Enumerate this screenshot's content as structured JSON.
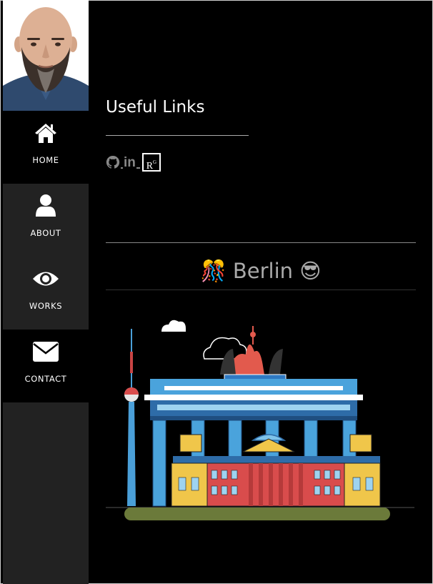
{
  "nav": {
    "items": [
      {
        "label": "HOME",
        "icon": "home-icon"
      },
      {
        "label": "ABOUT",
        "icon": "user-icon"
      },
      {
        "label": "WORKS",
        "icon": "eye-icon"
      },
      {
        "label": "CONTACT",
        "icon": "envelope-icon"
      }
    ]
  },
  "useful_links": {
    "title": "Useful Links",
    "links": [
      {
        "icon": "github-icon"
      },
      {
        "icon": "linkedin-icon",
        "text": "in"
      },
      {
        "icon": "researchgate-icon",
        "text": "R",
        "sup": "G"
      }
    ]
  },
  "city": {
    "emoji_left": "🎊",
    "name": "Berlin",
    "emoji_right": "😎"
  },
  "colors": {
    "background": "#000000",
    "sidebar": "#222222",
    "text": "#ffffff",
    "muted_text": "#aaaaaa"
  }
}
